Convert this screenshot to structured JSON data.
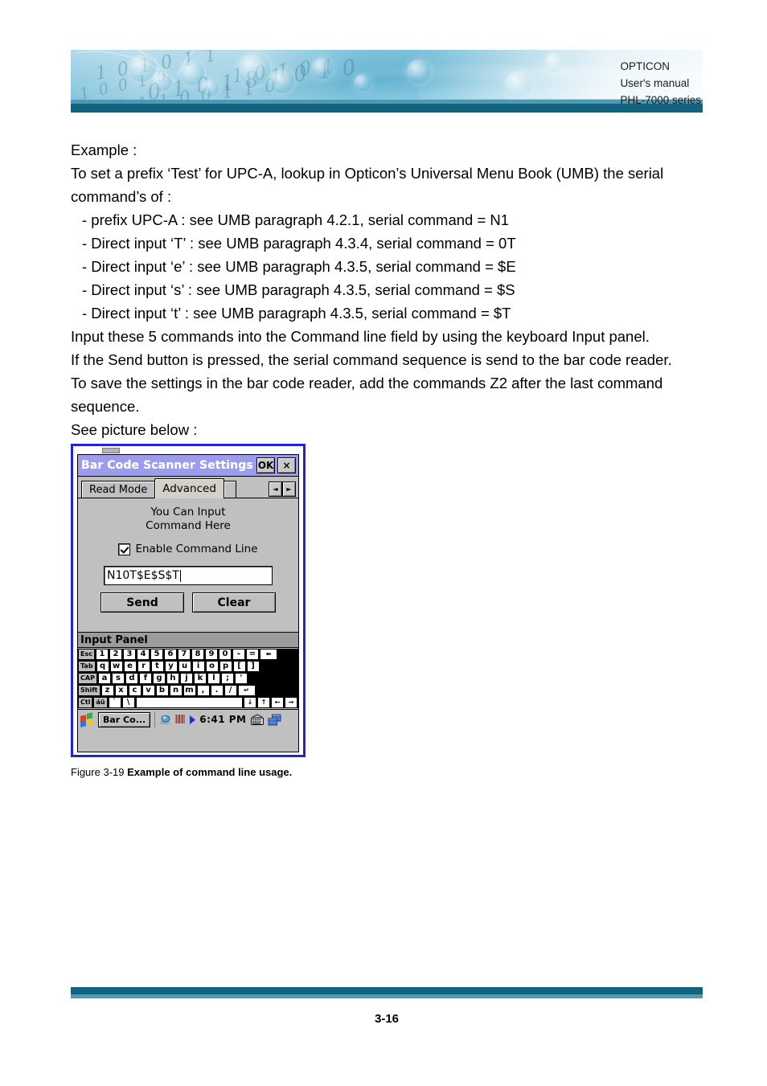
{
  "header": {
    "company": "OPTICON",
    "doc_type": "User's manual",
    "product": "PHL-7000 series",
    "accent_dark": "#13637f",
    "accent_light": "#4e9ab5"
  },
  "content": {
    "lines": [
      "Example :",
      "To set a prefix ‘Test’ for UPC-A, lookup in Opticon’s Universal Menu Book (UMB) the serial",
      "command’s of :"
    ],
    "bullets": [
      "- prefix UPC-A : see UMB paragraph 4.2.1, serial command = N1",
      "- Direct input ‘T’ : see UMB paragraph 4.3.4, serial command = 0T",
      "- Direct input ‘e’ : see UMB paragraph 4.3.5, serial command = $E",
      "- Direct input ‘s’ : see UMB paragraph 4.3.5, serial command = $S",
      "- Direct input ‘t’ : see UMB paragraph 4.3.5, serial command = $T"
    ],
    "lines2": [
      "Input these 5 commands into the Command line field by using the keyboard Input panel.",
      "If the Send button is pressed, the serial command sequence is send to the bar code reader.",
      "To save the settings in the bar code reader, add the commands Z2 after the last command",
      "sequence.",
      "See picture below :"
    ]
  },
  "pda": {
    "title": "Bar Code Scanner Settings",
    "ok_label": "OK",
    "close_label": "×",
    "tabs": [
      {
        "label": "Read Mode",
        "active": false
      },
      {
        "label": "Advanced",
        "active": true
      }
    ],
    "tab_prev": "◄",
    "tab_next": "►",
    "hint_line1": "You Can Input",
    "hint_line2": "Command Here",
    "checkbox_label": "Enable Command Line",
    "checkbox_checked": true,
    "command_value": "N10T$E$S$T",
    "send_label": "Send",
    "clear_label": "Clear",
    "input_panel_title": "Input Panel",
    "keyboard": {
      "row1": [
        "Esc",
        "1",
        "2",
        "3",
        "4",
        "5",
        "6",
        "7",
        "8",
        "9",
        "0",
        "-",
        "=",
        "⬅"
      ],
      "row2": [
        "Tab",
        "q",
        "w",
        "e",
        "r",
        "t",
        "y",
        "u",
        "i",
        "o",
        "p",
        "[",
        "]"
      ],
      "row3": [
        "CAP",
        "a",
        "s",
        "d",
        "f",
        "g",
        "h",
        "j",
        "k",
        "l",
        ";",
        "'"
      ],
      "row4": [
        "Shift",
        "z",
        "x",
        "c",
        "v",
        "b",
        "n",
        "m",
        ",",
        ".",
        "/",
        "↵"
      ],
      "row5": [
        "Ctl",
        "áü",
        "`",
        "\\",
        "",
        "↓",
        "↑",
        "←",
        "→"
      ]
    },
    "taskbar": {
      "task_label": "Bar Co...",
      "time": "6:41 PM"
    }
  },
  "caption": {
    "prefix": "Figure 3-19 ",
    "text": "Example of command line usage."
  },
  "footer": {
    "page": "3-16"
  }
}
